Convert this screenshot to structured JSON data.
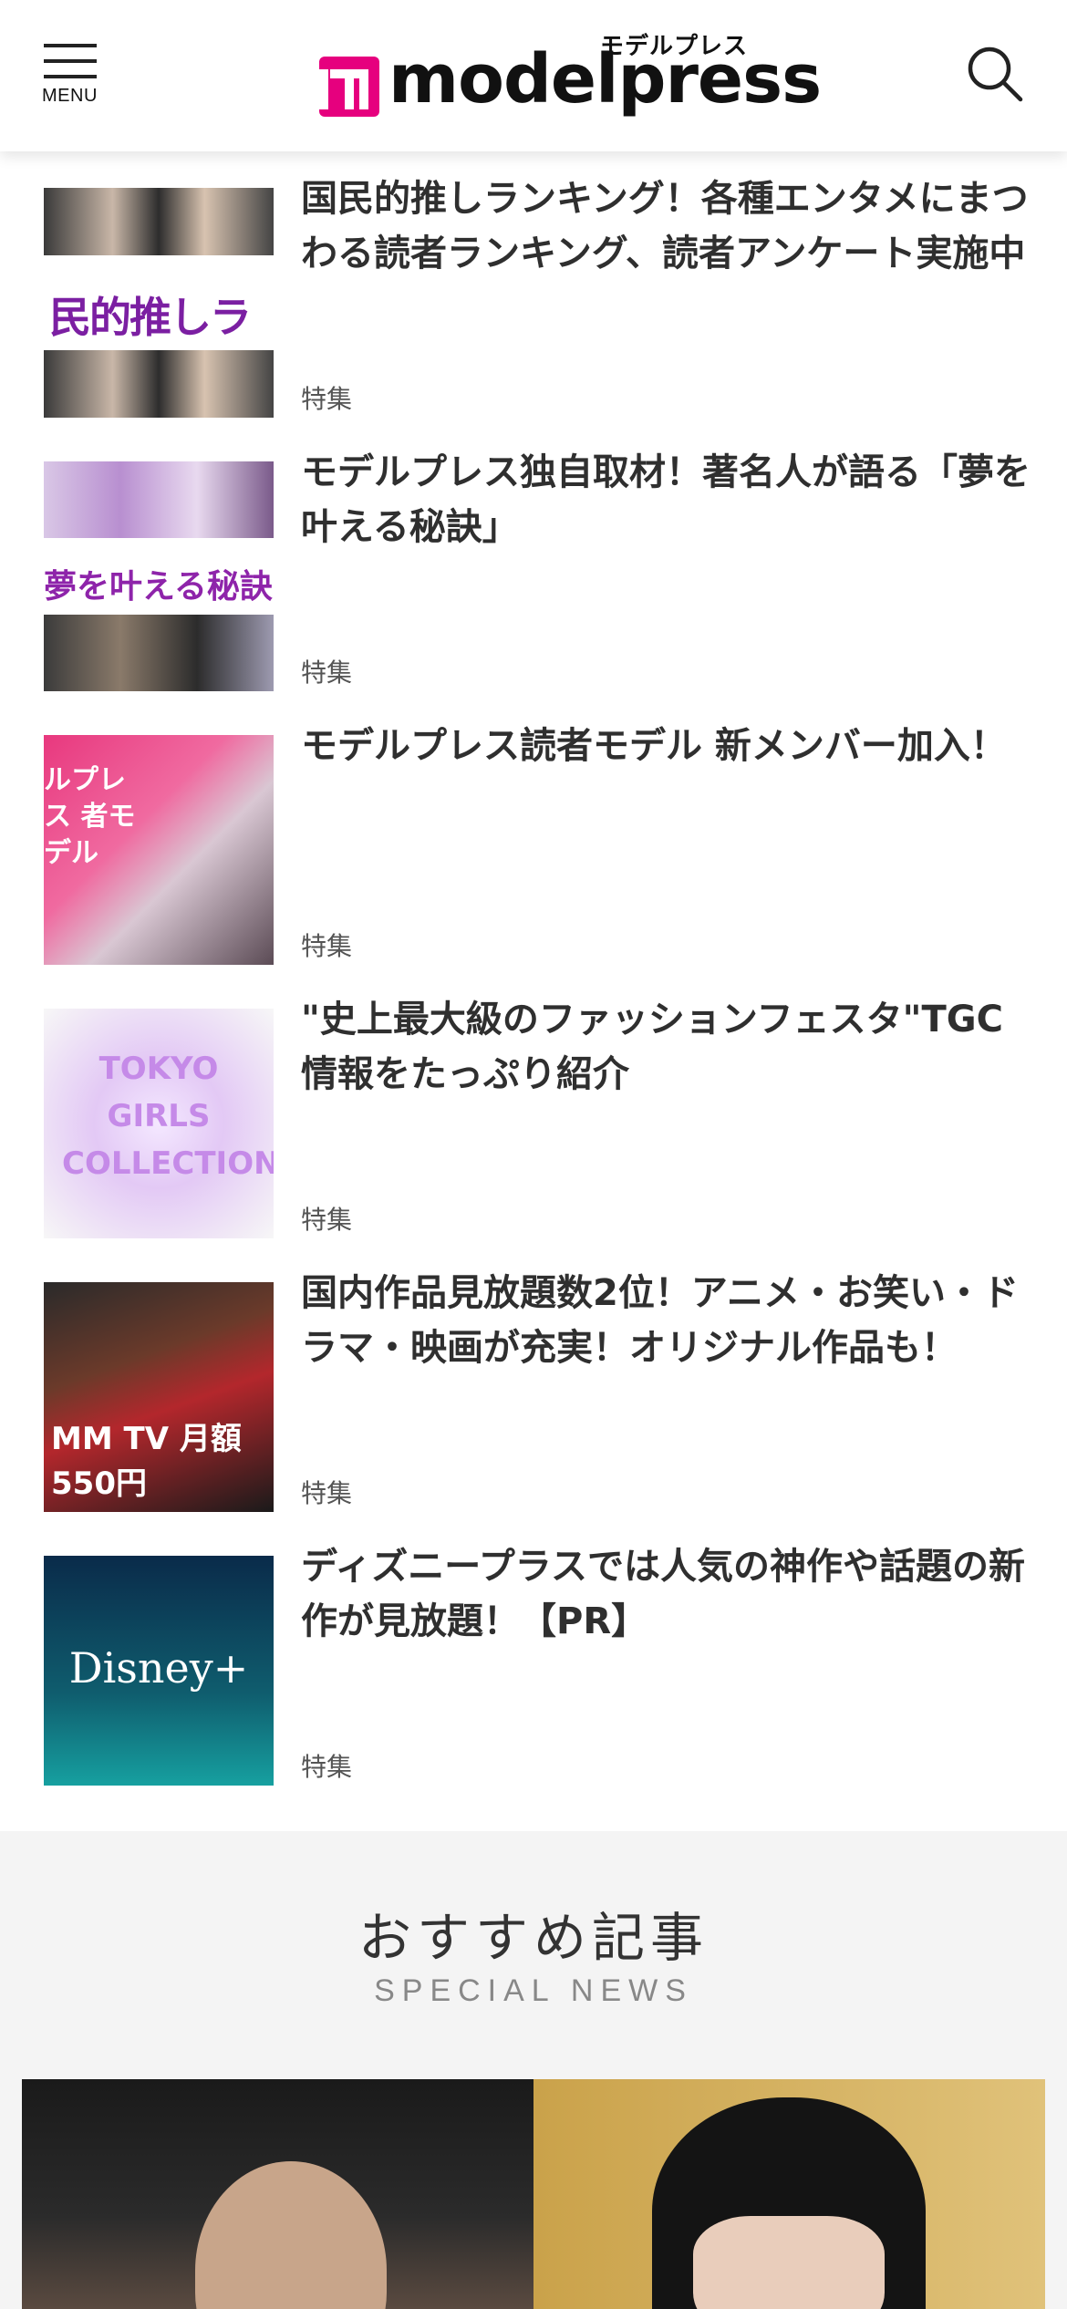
{
  "header": {
    "menu_label": "MENU",
    "logo_kana": "モデルプレス",
    "logo_text": "modelpress",
    "brand_color": "#e6007e",
    "icons": {
      "menu": "hamburger-menu-icon",
      "search": "search-icon"
    }
  },
  "features": [
    {
      "title": "国民的推しランキング！各種エンタメにまつわる読者ランキング、読者アンケート実施中",
      "tag": "特集",
      "thumb_text": "民的推しランキ"
    },
    {
      "title": "モデルプレス独自取材！著名人が語る「夢を叶える秘訣」",
      "tag": "特集",
      "thumb_text": "夢を叶える秘訣"
    },
    {
      "title": "モデルプレス読者モデル 新メンバー加入！",
      "tag": "特集",
      "thumb_text": "ルプレス 者モデル"
    },
    {
      "title": "\"史上最大級のファッションフェスタ\"TGC情報をたっぷり紹介",
      "tag": "特集",
      "thumb_text": "TOKYO GIRLS COLLECTION"
    },
    {
      "title": "国内作品見放題数2位！アニメ・お笑い・ドラマ・映画が充実！オリジナル作品も！",
      "tag": "特集",
      "thumb_text": "MM TV 月額550円"
    },
    {
      "title": "ディズニープラスでは人気の神作や話題の新作が見放題！【PR】",
      "tag": "特集",
      "thumb_text": "Disney+"
    }
  ],
  "special": {
    "title": "おすすめ記事",
    "subtitle": "SPECIAL NEWS"
  }
}
